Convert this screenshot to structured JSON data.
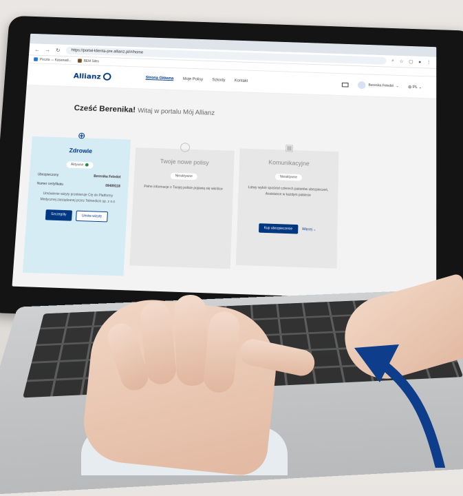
{
  "browser": {
    "url": "https://portal-klienta-pre.allianz.pl/#/home",
    "bookmarks": [
      "Poczta — Kasanadi...",
      "BEM Sites"
    ]
  },
  "site": {
    "logo": "Allianz",
    "nav": [
      "Strona Główna",
      "Moje Polisy",
      "Szkody",
      "Kontakt"
    ],
    "user": "Berenika Feledot",
    "language": "PL"
  },
  "greeting": {
    "hello": "Cześć Berenika!",
    "sub": "Witaj w portalu Mój Allianz"
  },
  "cards": {
    "health": {
      "title": "Zdrowie",
      "status": "Aktywne",
      "insured_label": "Ubezpieczony",
      "insured_value": "Berenika Feledot",
      "cert_label": "Numer certyfikatu",
      "cert_value": "09409118",
      "description": "Umówienie wizyty przekieruje Cię do Platformy Medycznej zarządzanej przez Telmedicin sp. z o.o",
      "btn_details": "Szczegóły",
      "btn_book": "Umów wizytę"
    },
    "new_policies": {
      "title": "Twoje nowe polisy",
      "status": "Nieaktywne",
      "description": "Pełne informacje o Twojej polisie pojawią się wkrótce"
    },
    "motor": {
      "title": "Komunikacyjne",
      "status": "Nieaktywne",
      "description": "Łatwy wybór spośród czterech pakietów ubezpieczeń, Assistance w każdym pakiecie",
      "btn_buy": "Kup ubezpieczenie",
      "more": "Więcej"
    }
  },
  "colors": {
    "brand": "#003781",
    "accent_arrow": "#0e3d8c",
    "health_card": "#d6ecf4"
  }
}
